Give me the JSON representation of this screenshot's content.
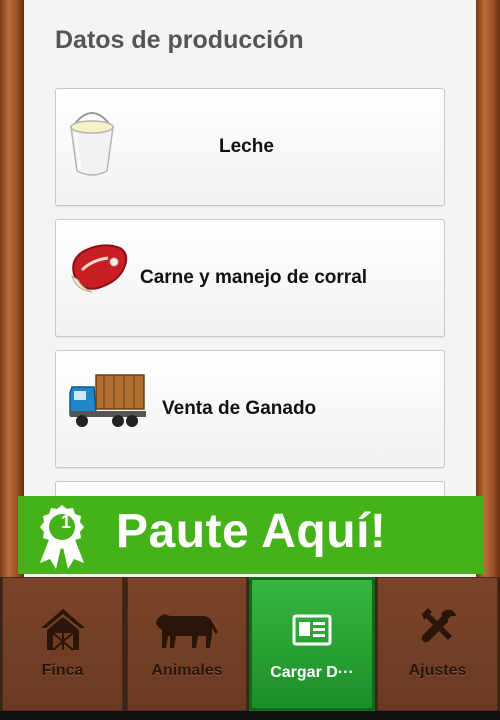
{
  "section_title": "Datos de producción",
  "cards": [
    {
      "label": "Leche",
      "icon": "milk-bucket-icon"
    },
    {
      "label": "Carne y manejo de corral",
      "icon": "meat-icon"
    },
    {
      "label": "Venta de Ganado",
      "icon": "truck-icon"
    }
  ],
  "banner": {
    "text": "Paute Aquí!",
    "badge_number": "1",
    "color": "#46b21a"
  },
  "tabs": [
    {
      "label": "Finca",
      "icon": "house-icon"
    },
    {
      "label": "Animales",
      "icon": "cow-icon"
    },
    {
      "label": "Cargar D···",
      "icon": "id-card-icon",
      "active": true
    },
    {
      "label": "Ajustes",
      "icon": "tools-icon"
    }
  ]
}
